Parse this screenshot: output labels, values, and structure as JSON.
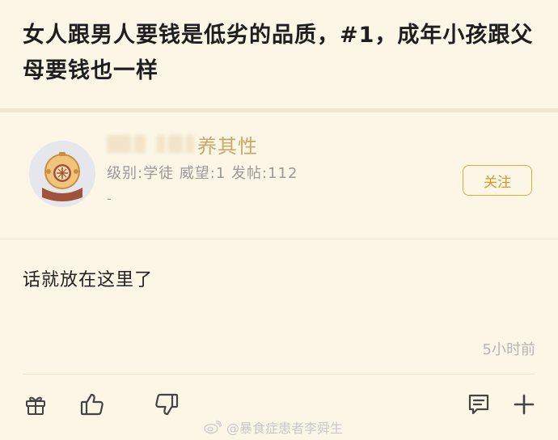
{
  "post": {
    "title": "女人跟男人要钱是低劣的品质，#1，成年小孩跟父母要钱也一样",
    "content": "话就放在这里了",
    "time": "5小时前"
  },
  "author": {
    "name_visible": "养其性",
    "meta": "级别:学徒 威望:1 发帖:112",
    "extra": "-",
    "avatar_icon": "diver-helmet-icon"
  },
  "buttons": {
    "follow": "关注"
  },
  "actions": [
    {
      "icon": "gift-icon"
    },
    {
      "icon": "thumbs-up-icon"
    },
    {
      "icon": "thumbs-down-icon"
    },
    {
      "icon": "comment-icon"
    },
    {
      "icon": "plus-icon"
    }
  ],
  "watermark": "@暴食症患者李舜生",
  "colors": {
    "background": "#fbf6e6",
    "accent": "#d9962a",
    "username": "#c9a86a"
  }
}
